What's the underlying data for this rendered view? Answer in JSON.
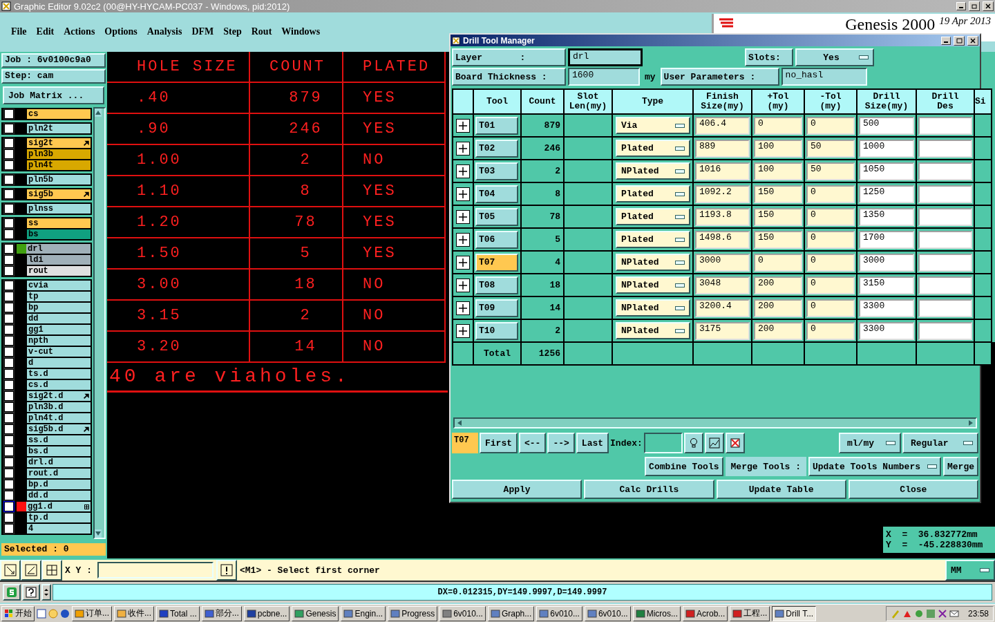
{
  "window": {
    "title": "Graphic Editor 9.02c2 (00@HY-HYCAM-PC037 - Windows, pid:2012)"
  },
  "menu": [
    "File",
    "Edit",
    "Actions",
    "Options",
    "Analysis",
    "DFM",
    "Step",
    "Rout",
    "Windows"
  ],
  "banner": {
    "product": "Genesis 2000",
    "date": "19 Apr 2013"
  },
  "job": {
    "job": "Job  :  6v0100c9a0",
    "step": "Step: cam",
    "matrix_button": "Job Matrix ..."
  },
  "layer_groups": [
    [
      {
        "name": "cs",
        "color": "#ffc850",
        "checked": false,
        "selected": false
      }
    ],
    [
      {
        "name": "pln2t",
        "color": "#a0dcdc",
        "checked": false,
        "selected": false
      }
    ],
    [
      {
        "name": "sig2t",
        "color": "#ffc850",
        "arrow": true,
        "checked": false,
        "selected": false
      },
      {
        "name": "pln3b",
        "color": "#d8a800",
        "checked": false,
        "selected": false
      },
      {
        "name": "pln4t",
        "color": "#d8a800",
        "checked": false,
        "selected": false
      }
    ],
    [
      {
        "name": "pln5b",
        "color": "#a0dcdc",
        "checked": false,
        "selected": false
      }
    ],
    [
      {
        "name": "sig5b",
        "color": "#ffc850",
        "arrow": true,
        "checked": false,
        "selected": false
      }
    ],
    [
      {
        "name": "plnss",
        "color": "#a0dcdc",
        "checked": false,
        "selected": false
      }
    ],
    [
      {
        "name": "ss",
        "color": "#ffc850",
        "checked": false,
        "selected": false
      },
      {
        "name": "bs",
        "color": "#10a080",
        "checked": false,
        "selected": false
      }
    ],
    [
      {
        "name": "drl",
        "color": "#a0b0b8",
        "marker": {
          "color": "#40a010"
        },
        "checked": false,
        "selected": false
      },
      {
        "name": "ldi",
        "color": "#a0b0b8",
        "checked": false,
        "selected": false
      },
      {
        "name": "rout",
        "color": "#e0e0e0",
        "checked": false,
        "selected": false
      }
    ],
    [
      {
        "name": "cvia",
        "color": "#a0dcdc",
        "checked": false,
        "selected": false
      },
      {
        "name": "tp",
        "color": "#a0dcdc",
        "checked": false,
        "selected": false
      },
      {
        "name": "bp",
        "color": "#a0dcdc",
        "checked": false,
        "selected": false
      },
      {
        "name": "dd",
        "color": "#a0dcdc",
        "checked": false,
        "selected": false
      },
      {
        "name": "gg1",
        "color": "#a0dcdc",
        "checked": false,
        "selected": false
      },
      {
        "name": "npth",
        "color": "#a0dcdc",
        "checked": false,
        "selected": false
      },
      {
        "name": "v-cut",
        "color": "#a0dcdc",
        "checked": false,
        "selected": false
      },
      {
        "name": "d",
        "color": "#a0dcdc",
        "checked": false,
        "selected": false
      },
      {
        "name": "ts.d",
        "color": "#a0dcdc",
        "checked": false,
        "selected": false
      },
      {
        "name": "cs.d",
        "color": "#a0dcdc",
        "checked": false,
        "selected": false
      },
      {
        "name": "sig2t.d",
        "color": "#a0dcdc",
        "arrow": true,
        "checked": false,
        "selected": false
      },
      {
        "name": "pln3b.d",
        "color": "#a0dcdc",
        "checked": false,
        "selected": false
      },
      {
        "name": "pln4t.d",
        "color": "#a0dcdc",
        "checked": false,
        "selected": false
      },
      {
        "name": "sig5b.d",
        "color": "#a0dcdc",
        "arrow": true,
        "checked": false,
        "selected": false
      },
      {
        "name": "ss.d",
        "color": "#a0dcdc",
        "checked": false,
        "selected": false
      },
      {
        "name": "bs.d",
        "color": "#a0dcdc",
        "checked": false,
        "selected": false
      },
      {
        "name": "drl.d",
        "color": "#a0dcdc",
        "checked": false,
        "selected": false
      },
      {
        "name": "rout.d",
        "color": "#a0dcdc",
        "checked": false,
        "selected": false
      },
      {
        "name": "bp.d",
        "color": "#a0dcdc",
        "checked": false,
        "selected": false
      },
      {
        "name": "dd.d",
        "color": "#a0dcdc",
        "checked": false,
        "selected": false
      },
      {
        "name": "gg1.d",
        "color": "#a0dcdc",
        "marker": {
          "color": "#ff1010"
        },
        "grid": true,
        "checked": false,
        "selected": true
      },
      {
        "name": "tp.d",
        "color": "#a0dcdc",
        "checked": false,
        "selected": false
      },
      {
        "name": "4",
        "color": "#a0dcdc",
        "checked": false,
        "selected": false
      }
    ]
  ],
  "selected_count": "Selected : 0",
  "canvas_table": {
    "columns": [
      "HOLE SIZE",
      "COUNT",
      "PLATED"
    ],
    "rows": [
      [
        ".40",
        "879",
        "YES"
      ],
      [
        ".90",
        "246",
        "YES"
      ],
      [
        "1.00",
        "2",
        "NO"
      ],
      [
        "1.10",
        "8",
        "YES"
      ],
      [
        "1.20",
        "78",
        "YES"
      ],
      [
        "1.50",
        "5",
        "YES"
      ],
      [
        "3.00",
        "18",
        "NO"
      ],
      [
        "3.15",
        "2",
        "NO"
      ],
      [
        "3.20",
        "14",
        "NO"
      ]
    ],
    "note": "40 are viaholes."
  },
  "coordinates": {
    "x": "X  =  36.832772mm",
    "y": "Y  =  -45.228830mm"
  },
  "command_bar": {
    "xy_label": "X Y :",
    "message": "<M1> - Select first corner",
    "units": "MM"
  },
  "status": "DX=0.012315,DY=149.9997,D=149.9997",
  "dialog": {
    "title": "Drill Tool Manager",
    "layer_label": "Layer       :",
    "layer": "drl",
    "slots_label": "Slots:",
    "slots": "Yes",
    "thickness_label": "Board Thickness :",
    "thickness": "1600",
    "thickness_unit": "my",
    "user_params_label": "User Parameters :",
    "user_params": "no_hasl",
    "columns": [
      "Tool",
      "Count",
      "Slot\nLen(my)",
      "Type",
      "Finish\nSize(my)",
      "+Tol\n(my)",
      "-Tol\n(my)",
      "Drill\nSize(my)",
      "Drill\nDes",
      "Si"
    ],
    "rows": [
      {
        "tool": "T01",
        "count": "879",
        "type": "Via",
        "finish": "406.4",
        "plus_tol": "0",
        "minus_tol": "0",
        "drill": "500",
        "selected": false
      },
      {
        "tool": "T02",
        "count": "246",
        "type": "Plated",
        "finish": "889",
        "plus_tol": "100",
        "minus_tol": "50",
        "drill": "1000",
        "selected": false
      },
      {
        "tool": "T03",
        "count": "2",
        "type": "NPlated",
        "finish": "1016",
        "plus_tol": "100",
        "minus_tol": "50",
        "drill": "1050",
        "selected": false
      },
      {
        "tool": "T04",
        "count": "8",
        "type": "Plated",
        "finish": "1092.2",
        "plus_tol": "150",
        "minus_tol": "0",
        "drill": "1250",
        "selected": false
      },
      {
        "tool": "T05",
        "count": "78",
        "type": "Plated",
        "finish": "1193.8",
        "plus_tol": "150",
        "minus_tol": "0",
        "drill": "1350",
        "selected": false
      },
      {
        "tool": "T06",
        "count": "5",
        "type": "Plated",
        "finish": "1498.6",
        "plus_tol": "150",
        "minus_tol": "0",
        "drill": "1700",
        "selected": false
      },
      {
        "tool": "T07",
        "count": "4",
        "type": "NPlated",
        "finish": "3000",
        "plus_tol": "0",
        "minus_tol": "0",
        "drill": "3000",
        "selected": true
      },
      {
        "tool": "T08",
        "count": "18",
        "type": "NPlated",
        "finish": "3048",
        "plus_tol": "200",
        "minus_tol": "0",
        "drill": "3150",
        "selected": false
      },
      {
        "tool": "T09",
        "count": "14",
        "type": "NPlated",
        "finish": "3200.4",
        "plus_tol": "200",
        "minus_tol": "0",
        "drill": "3300",
        "selected": false
      },
      {
        "tool": "T10",
        "count": "2",
        "type": "NPlated",
        "finish": "3175",
        "plus_tol": "200",
        "minus_tol": "0",
        "drill": "3300",
        "selected": false
      }
    ],
    "total_label": "Total",
    "total": "1256",
    "current_tool": "T07",
    "nav": [
      "First",
      "<--",
      "-->",
      "Last"
    ],
    "index_label": "Index:",
    "unit_mode": "ml/my",
    "size_mode": "Regular",
    "combine": "Combine Tools",
    "merge_label": "Merge Tools :",
    "merge_mode": "Update Tools Numbers",
    "merge": "Merge",
    "actions": [
      "Apply",
      "Calc Drills",
      "Update Table",
      "Close"
    ]
  },
  "taskbar": {
    "start": "开始",
    "tasks": [
      {
        "label": "订单...",
        "selected": false
      },
      {
        "label": "收件...",
        "selected": false
      },
      {
        "label": "Total ...",
        "selected": false
      },
      {
        "label": "部分...",
        "selected": false
      },
      {
        "label": "pcbne...",
        "selected": false
      },
      {
        "label": "Genesis",
        "selected": false
      },
      {
        "label": "Engin...",
        "selected": false
      },
      {
        "label": "Progress",
        "selected": false
      },
      {
        "label": "6v010...",
        "selected": false
      },
      {
        "label": "Graph...",
        "selected": false
      },
      {
        "label": "6v010...",
        "selected": false
      },
      {
        "label": "6v010...",
        "selected": false
      },
      {
        "label": "Micros...",
        "selected": false
      },
      {
        "label": "Acrob...",
        "selected": false
      },
      {
        "label": "工程...",
        "selected": false
      },
      {
        "label": "Drill T...",
        "selected": true
      }
    ],
    "clock": "23:58"
  }
}
